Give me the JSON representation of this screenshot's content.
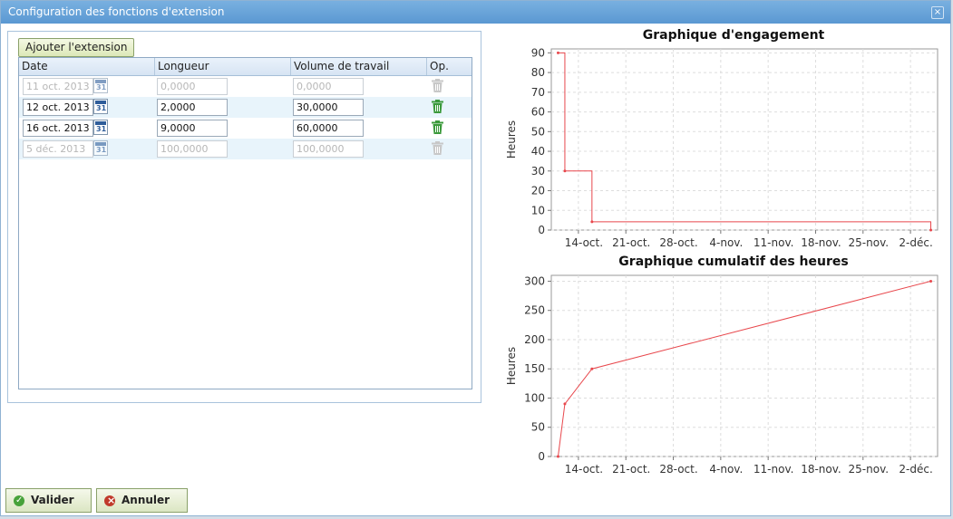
{
  "window": {
    "title": "Configuration des fonctions d'extension",
    "close_glyph": "×"
  },
  "toolbar": {
    "add_label": "Ajouter l'extension"
  },
  "grid": {
    "columns": [
      "Date",
      "Longueur",
      "Volume de travail",
      "Op."
    ],
    "rows": [
      {
        "date": "11 oct. 2013",
        "length": "0,0000",
        "workload": "0,0000",
        "enabled": false
      },
      {
        "date": "12 oct. 2013",
        "length": "2,0000",
        "workload": "30,0000",
        "enabled": true
      },
      {
        "date": "16 oct. 2013",
        "length": "9,0000",
        "workload": "60,0000",
        "enabled": true
      },
      {
        "date": "5 déc. 2013",
        "length": "100,0000",
        "workload": "100,0000",
        "enabled": false
      }
    ]
  },
  "actions": {
    "validate_label": "Valider",
    "cancel_label": "Annuler"
  },
  "colors": {
    "series": "#e8474c",
    "trash_active": "#3c9a3c",
    "trash_disabled": "#c8c8c8"
  },
  "chart_data": [
    {
      "type": "line",
      "title": "Graphique d'engagement",
      "ylabel": "Heures",
      "xlabel": "",
      "ylim": [
        0,
        92
      ],
      "yticks": [
        0,
        10,
        20,
        30,
        40,
        50,
        60,
        70,
        80,
        90
      ],
      "xlim": [
        "2013-10-10",
        "2013-12-06"
      ],
      "xticks": [
        {
          "date": "2013-10-14",
          "label": "14-oct."
        },
        {
          "date": "2013-10-21",
          "label": "21-oct."
        },
        {
          "date": "2013-10-28",
          "label": "28-oct."
        },
        {
          "date": "2013-11-04",
          "label": "4-nov."
        },
        {
          "date": "2013-11-11",
          "label": "11-nov."
        },
        {
          "date": "2013-11-18",
          "label": "18-nov."
        },
        {
          "date": "2013-11-25",
          "label": "25-nov."
        },
        {
          "date": "2013-12-02",
          "label": "2-déc."
        }
      ],
      "grid": true,
      "series": [
        {
          "step": true,
          "points": [
            {
              "x": "2013-10-11",
              "y": 90
            },
            {
              "x": "2013-10-12",
              "y": 30
            },
            {
              "x": "2013-10-16",
              "y": 4.2
            },
            {
              "x": "2013-12-05",
              "y": 0
            }
          ]
        }
      ]
    },
    {
      "type": "line",
      "title": "Graphique cumulatif des heures",
      "ylabel": "Heures",
      "xlabel": "",
      "ylim": [
        0,
        310
      ],
      "yticks": [
        0,
        50,
        100,
        150,
        200,
        250,
        300
      ],
      "xlim": [
        "2013-10-10",
        "2013-12-06"
      ],
      "xticks": [
        {
          "date": "2013-10-14",
          "label": "14-oct."
        },
        {
          "date": "2013-10-21",
          "label": "21-oct."
        },
        {
          "date": "2013-10-28",
          "label": "28-oct."
        },
        {
          "date": "2013-11-04",
          "label": "4-nov."
        },
        {
          "date": "2013-11-11",
          "label": "11-nov."
        },
        {
          "date": "2013-11-18",
          "label": "18-nov."
        },
        {
          "date": "2013-11-25",
          "label": "25-nov."
        },
        {
          "date": "2013-12-02",
          "label": "2-déc."
        }
      ],
      "grid": true,
      "series": [
        {
          "step": false,
          "points": [
            {
              "x": "2013-10-11",
              "y": 0
            },
            {
              "x": "2013-10-12",
              "y": 90
            },
            {
              "x": "2013-10-16",
              "y": 150
            },
            {
              "x": "2013-12-05",
              "y": 300
            }
          ]
        }
      ]
    }
  ]
}
